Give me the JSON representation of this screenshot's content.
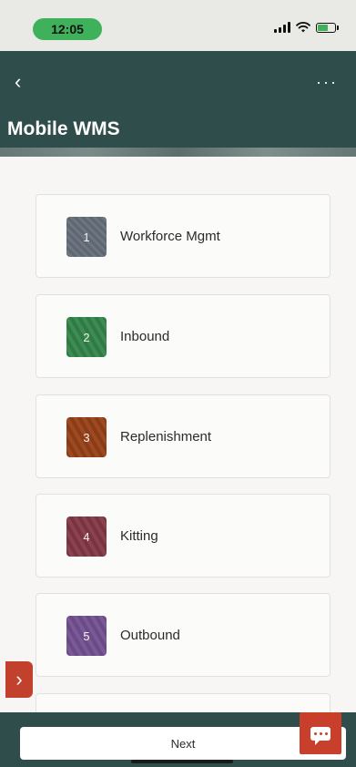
{
  "status_bar": {
    "time": "12:05"
  },
  "header": {
    "back_glyph": "‹",
    "more_glyph": "···",
    "title": "Mobile WMS"
  },
  "cards": [
    {
      "number": "1",
      "label": "Workforce Mgmt",
      "color": "#66707a"
    },
    {
      "number": "2",
      "label": "Inbound",
      "color": "#358049"
    },
    {
      "number": "3",
      "label": "Replenishment",
      "color": "#93431d"
    },
    {
      "number": "4",
      "label": "Kitting",
      "color": "#823a48"
    },
    {
      "number": "5",
      "label": "Outbound",
      "color": "#72528e"
    }
  ],
  "drawer_toggle": {
    "glyph": "›"
  },
  "footer": {
    "next_label": "Next"
  },
  "colors": {
    "header_bg": "#2e4d4b",
    "accent_red": "#c8402b",
    "time_pill": "#3fb15a"
  },
  "icons": {
    "back": "chevron-left-icon",
    "more": "more-icon",
    "drawer": "chevron-right-icon",
    "chat": "chat-icon",
    "signal": "signal-icon",
    "wifi": "wifi-icon",
    "battery": "battery-icon"
  }
}
